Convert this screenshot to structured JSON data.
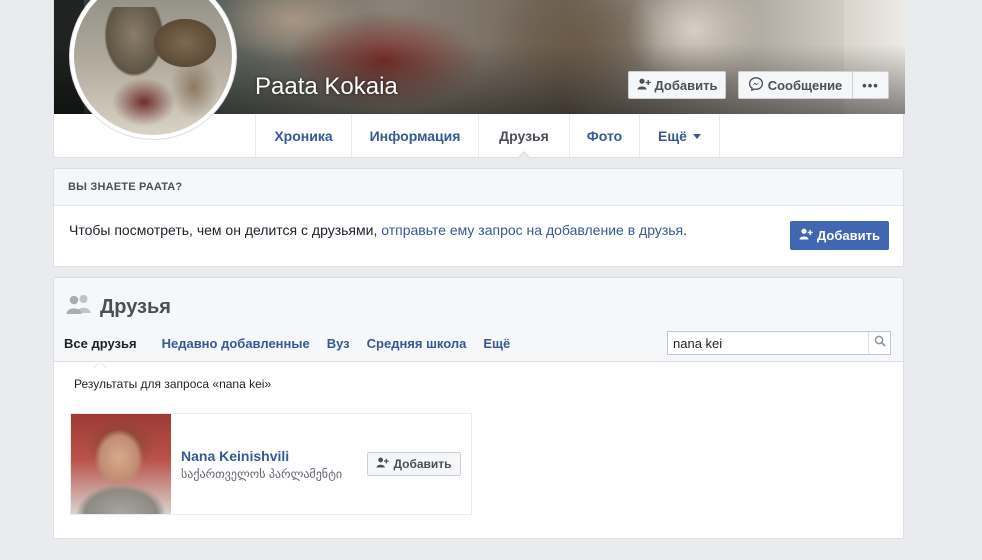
{
  "profile": {
    "name": "Paata Kokaia",
    "add_label": "Добавить",
    "message_label": "Сообщение",
    "more_label": "•••"
  },
  "tabs": [
    {
      "label": "Хроника"
    },
    {
      "label": "Информация"
    },
    {
      "label": "Друзья"
    },
    {
      "label": "Фото"
    },
    {
      "label": "Ещё"
    }
  ],
  "know_card": {
    "heading": "ВЫ ЗНАЕТЕ PAATA?",
    "text_prefix": "Чтобы посмотреть, чем он делится с друзьями,",
    "link_text": "отправьте ему запрос на добавление в друзья",
    "text_suffix": ".",
    "add_label": "Добавить"
  },
  "friends": {
    "title": "Друзья",
    "tabs": [
      {
        "label": "Все друзья"
      },
      {
        "label": "Недавно добавленные"
      },
      {
        "label": "Вуз"
      },
      {
        "label": "Средняя школа"
      },
      {
        "label": "Ещё"
      }
    ],
    "search_value": "nana kei",
    "results_label": "Результаты для запроса «nana kei»",
    "results": [
      {
        "name": "Nana Keinishvili",
        "subtitle": "საქართველოს პარლამენტი",
        "add_label": "Добавить"
      }
    ]
  },
  "colors": {
    "link": "#365899",
    "primary_button": "#4267b2",
    "page_bg": "#e9ebee"
  },
  "icons": {
    "add_friend": "add-friend-icon",
    "messenger": "messenger-icon",
    "friends": "friends-icon",
    "search": "search-icon"
  }
}
